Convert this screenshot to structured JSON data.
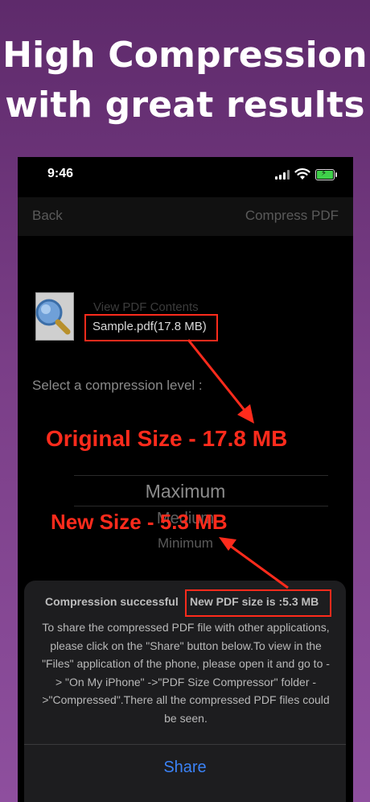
{
  "promo": {
    "line1": "High Compression",
    "line2": "with great results"
  },
  "status_bar": {
    "time": "9:46"
  },
  "navbar": {
    "back_label": "Back",
    "title": "Compress PDF"
  },
  "file": {
    "view_contents_label": "View PDF Contents",
    "name_size": "Sample.pdf(17.8 MB)"
  },
  "compression": {
    "select_label": "Select a compression level :",
    "options": [
      "Maximum",
      "Medium",
      "Minimum"
    ]
  },
  "annotations": {
    "original_size": "Original Size - 17.8 MB",
    "new_size": "New Size - 5.3 MB",
    "color": "#ff2b1c"
  },
  "sheet": {
    "title": "Compression successful",
    "new_size": "New PDF size is :5.3 MB",
    "message": "To share the compressed PDF file with other applications, please click on the \"Share\" button below.To view in the \"Files\" application of the phone, please open it and go to -> \"On My iPhone\" ->\"PDF Size Compressor\" folder ->\"Compressed\".There all the compressed PDF files could be seen.",
    "share_label": "Share"
  },
  "colors": {
    "background_top": "#5e2a6b",
    "background_bottom": "#8e4f9e",
    "share_blue": "#3b82f6",
    "battery_green": "#3fd04a"
  },
  "icons": [
    "signal-icon",
    "wifi-icon",
    "battery-icon",
    "pdf-magnifier-icon",
    "arrow-icon"
  ]
}
